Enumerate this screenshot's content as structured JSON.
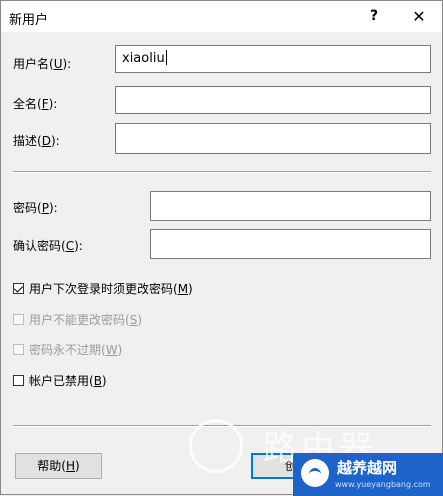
{
  "window": {
    "title": "新用户",
    "help_label": "?",
    "close_label": "✕"
  },
  "form": {
    "username": {
      "label_pre": "用户名(",
      "label_key": "U",
      "label_post": "):",
      "value": "xiaoliu"
    },
    "fullname": {
      "label_pre": "全名(",
      "label_key": "F",
      "label_post": "):",
      "value": ""
    },
    "description": {
      "label_pre": "描述(",
      "label_key": "D",
      "label_post": "):",
      "value": ""
    },
    "password": {
      "label_pre": "密码(",
      "label_key": "P",
      "label_post": "):",
      "value": ""
    },
    "confirm_password": {
      "label_pre": "确认密码(",
      "label_key": "C",
      "label_post": "):",
      "value": ""
    }
  },
  "options": [
    {
      "pre": "用户下次登录时须更改密码(",
      "key": "M",
      "post": ")",
      "checked": true,
      "enabled": true
    },
    {
      "pre": "用户不能更改密码(",
      "key": "S",
      "post": ")",
      "checked": false,
      "enabled": false
    },
    {
      "pre": "密码永不过期(",
      "key": "W",
      "post": ")",
      "checked": false,
      "enabled": false
    },
    {
      "pre": "帐户已禁用(",
      "key": "B",
      "post": ")",
      "checked": false,
      "enabled": true
    }
  ],
  "buttons": {
    "help": {
      "pre": "帮助(",
      "key": "H",
      "post": ")"
    },
    "create": {
      "label": "创"
    }
  },
  "watermark": {
    "brand_big": "路由器",
    "brand_small": "越养越网",
    "url": "www.yueyangbang.com"
  }
}
